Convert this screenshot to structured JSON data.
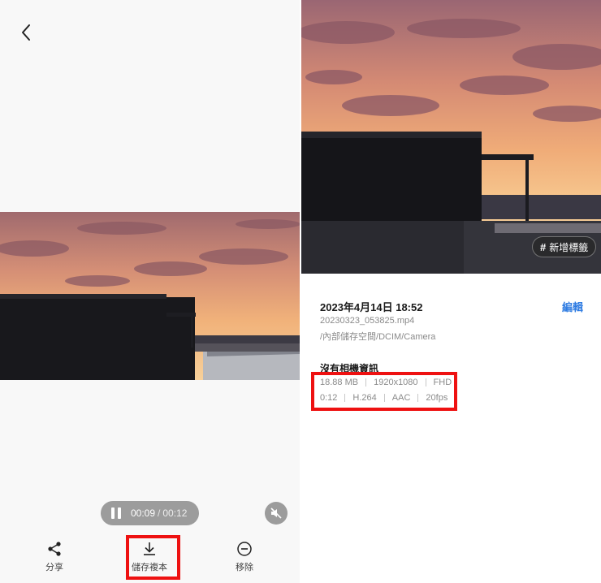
{
  "viewer": {
    "back_icon": "chevron-left-icon",
    "playback": {
      "current_time": "00:09",
      "separator": "/",
      "total_time": "00:12",
      "pause_icon": "pause-icon",
      "mute_icon": "volume-off-icon"
    },
    "bottom_bar": [
      {
        "id": "share",
        "icon": "share-icon",
        "label": "分享"
      },
      {
        "id": "save_copy",
        "icon": "download-icon",
        "label": "儲存複本"
      },
      {
        "id": "remove",
        "icon": "minus-circle-icon",
        "label": "移除"
      }
    ]
  },
  "details": {
    "add_tag_label": "# 新增標籤",
    "add_tag_hash": "#",
    "add_tag_text": "新增標籤",
    "date_time": "2023年4月14日 18:52",
    "edit_label": "編輯",
    "file_name": "20230323_053825.mp4",
    "file_path": "/內部儲存空間/DCIM/Camera",
    "camera_info": "沒有相機資訊",
    "specs_row1": [
      "18.88 MB",
      "1920x1080",
      "FHD"
    ],
    "specs_row2": [
      "0:12",
      "H.264",
      "AAC",
      "20fps"
    ]
  },
  "colors": {
    "accent_blue": "#2f7ce2",
    "highlight_red": "#ee1111",
    "pill_gray": "#9c9c9c"
  }
}
